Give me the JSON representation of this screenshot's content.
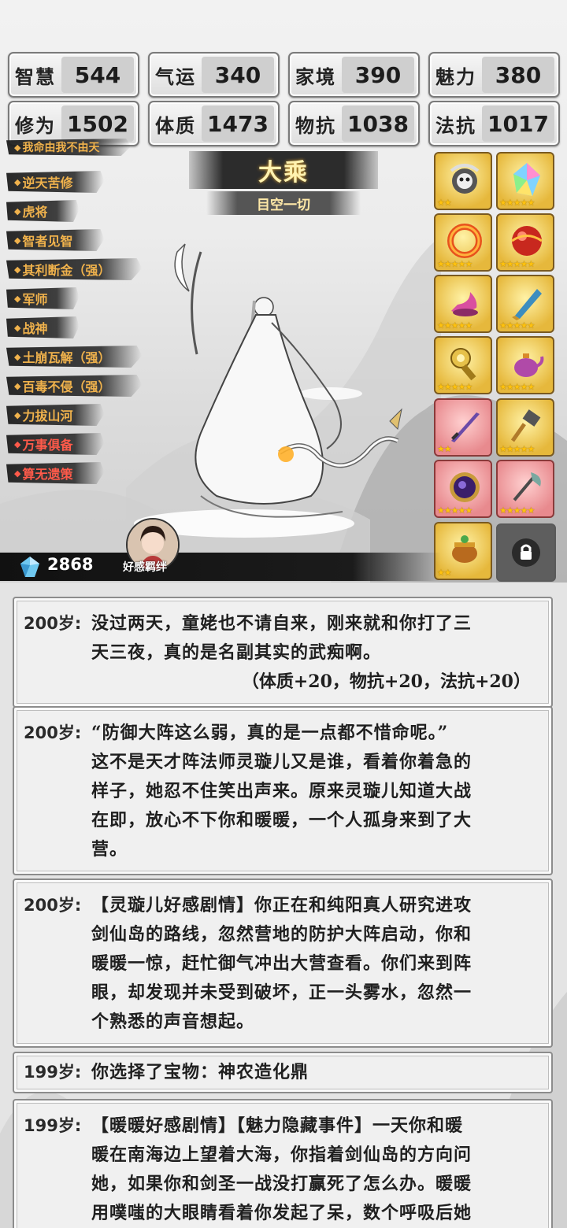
{
  "stats": [
    {
      "label": "智慧",
      "value": "544"
    },
    {
      "label": "气运",
      "value": "340"
    },
    {
      "label": "家境",
      "value": "390"
    },
    {
      "label": "魅力",
      "value": "380"
    },
    {
      "label": "修为",
      "value": "1502"
    },
    {
      "label": "体质",
      "value": "1473"
    },
    {
      "label": "物抗",
      "value": "1038"
    },
    {
      "label": "法抗",
      "value": "1017"
    }
  ],
  "traits": [
    {
      "label": "我命由我不由天",
      "color": "#f0b24c"
    },
    {
      "label": "逆天苦修",
      "color": "#f0b24c"
    },
    {
      "label": "虎将",
      "color": "#f0b24c"
    },
    {
      "label": "智者见智",
      "color": "#f0b24c"
    },
    {
      "label": "其利断金（强）",
      "color": "#f0b24c"
    },
    {
      "label": "军师",
      "color": "#f0b24c"
    },
    {
      "label": "战神",
      "color": "#f0b24c"
    },
    {
      "label": "土崩瓦解（强）",
      "color": "#f0b24c"
    },
    {
      "label": "百毒不侵（强）",
      "color": "#f0b24c"
    },
    {
      "label": "力拔山河",
      "color": "#f0b24c"
    },
    {
      "label": "万事俱备",
      "color": "#ff5a4a"
    },
    {
      "label": "算无遗策",
      "color": "#ff5a4a"
    }
  ],
  "realm": {
    "title": "大乘",
    "subtitle": "目空一切"
  },
  "items": [
    {
      "icon": "skull-orb-icon",
      "stars": "★★",
      "bg": "gold"
    },
    {
      "icon": "rainbow-crystal-icon",
      "stars": "★★★★★",
      "bg": "gold"
    },
    {
      "icon": "fire-ring-icon",
      "stars": "★★★★★",
      "bg": "gold"
    },
    {
      "icon": "red-orb-icon",
      "stars": "★★★★★",
      "bg": "gold"
    },
    {
      "icon": "pink-horn-icon",
      "stars": "★★★★★",
      "bg": "gold"
    },
    {
      "icon": "jade-blade-icon",
      "stars": "★★★★★",
      "bg": "gold"
    },
    {
      "icon": "golden-mace-icon",
      "stars": "★★★★★",
      "bg": "gold"
    },
    {
      "icon": "purple-teapot-icon",
      "stars": "★★★★★",
      "bg": "gold"
    },
    {
      "icon": "purple-sword-icon",
      "stars": "★★",
      "bg": "pink"
    },
    {
      "icon": "war-hammer-icon",
      "stars": "★★★★★",
      "bg": "gold"
    },
    {
      "icon": "void-mirror-icon",
      "stars": "★★★★★",
      "bg": "pink"
    },
    {
      "icon": "halberd-icon",
      "stars": "★★★★★",
      "bg": "pink"
    },
    {
      "icon": "cauldron-icon",
      "stars": "★★",
      "bg": "gold"
    }
  ],
  "currency": {
    "icon": "crystal-gem-icon",
    "count": "2868"
  },
  "bond": {
    "label": "好感羁绊"
  },
  "events": [
    {
      "age": "200岁:",
      "lines": [
        "没过两天，童姥也不请自来，刚来就和你打了三",
        "天三夜，真的是名副其实的武痴啊。"
      ],
      "bonus": "（体质+20，物抗+20，法抗+20）"
    },
    {
      "age": "200岁:",
      "lines": [
        "“防御大阵这么弱，真的是一点都不惜命呢。”",
        "这不是天才阵法师灵璇儿又是谁，看着你着急的",
        "样子，她忍不住笑出声来。原来灵璇儿知道大战",
        "在即，放心不下你和暖暖，一个人孤身来到了大",
        "营。"
      ],
      "bonus": ""
    },
    {
      "age": "200岁:",
      "lines": [
        "【灵璇儿好感剧情】你正在和纯阳真人研究进攻",
        "剑仙岛的路线，忽然营地的防护大阵启动，你和",
        "暖暖一惊，赶忙御气冲出大营查看。你们来到阵",
        "眼，却发现并未受到破坏，正一头雾水，忽然一",
        "个熟悉的声音想起。"
      ],
      "bonus": ""
    },
    {
      "age": "199岁:",
      "lines": [
        "你选择了宝物：神农造化鼎"
      ],
      "bonus": ""
    },
    {
      "age": "199岁:",
      "lines": [
        "【暖暖好感剧情】【魅力隐藏事件】一天你和暖",
        "暖在南海边上望着大海，你指着剑仙岛的方向问",
        "她，如果你和剑圣一战没打赢死了怎么办。暖暖",
        "用噗嗤的大眼睛看着你发起了呆，数个呼吸后她"
      ],
      "bonus": ""
    }
  ]
}
